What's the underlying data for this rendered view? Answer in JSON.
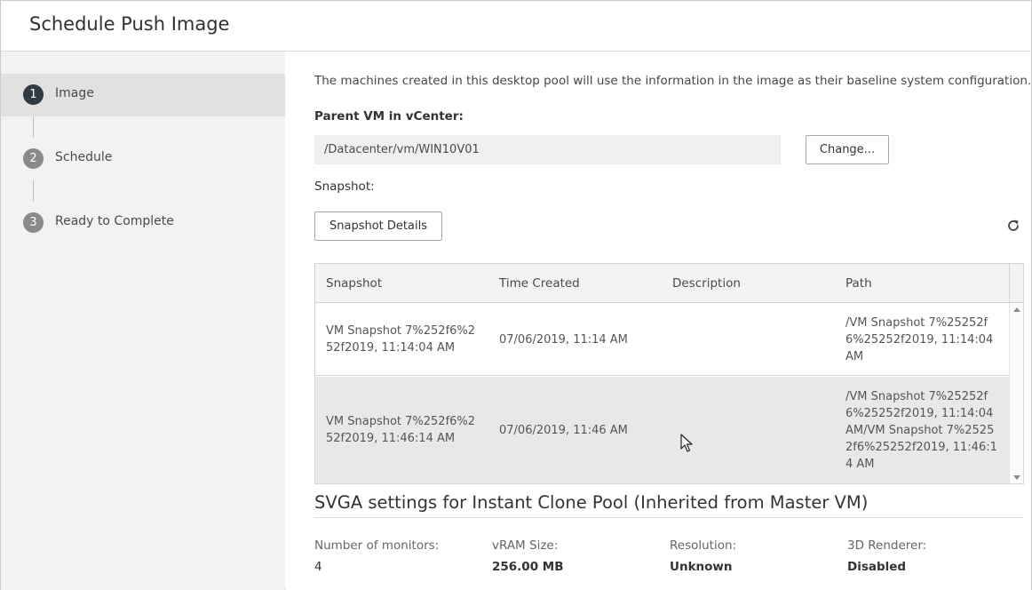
{
  "dialog": {
    "title": "Schedule Push Image"
  },
  "steps": [
    {
      "number": "1",
      "label": "Image",
      "active": true
    },
    {
      "number": "2",
      "label": "Schedule",
      "active": false
    },
    {
      "number": "3",
      "label": "Ready to Complete",
      "active": false
    }
  ],
  "image": {
    "intro_text": "The machines created in this desktop pool will use the information in the image as their baseline system configuration.",
    "parent_vm_label": "Parent VM in vCenter:",
    "parent_vm_value": "/Datacenter/vm/WIN10V01",
    "change_button": "Change...",
    "snapshot_label": "Snapshot:",
    "snapshot_details_button": "Snapshot Details",
    "refresh_icon": "refresh-icon"
  },
  "snapshot_table": {
    "columns": [
      "Snapshot",
      "Time Created",
      "Description",
      "Path"
    ],
    "rows": [
      {
        "snapshot": [
          "VM Snapshot 7%252f6%2",
          "52f2019, 11:14:04 AM"
        ],
        "time_created": "07/06/2019, 11:14 AM",
        "description": "",
        "path": [
          "/VM Snapshot 7%25252f",
          "6%25252f2019, 11:14:04",
          "AM"
        ],
        "selected": false
      },
      {
        "snapshot": [
          "VM Snapshot 7%252f6%2",
          "52f2019, 11:46:14 AM"
        ],
        "time_created": "07/06/2019, 11:46 AM",
        "description": "",
        "path": [
          "/VM Snapshot 7%25252f",
          "6%25252f2019, 11:14:04",
          "AM/VM Snapshot 7%2525",
          "2f6%25252f2019, 11:46:1",
          "4 AM"
        ],
        "selected": true
      }
    ]
  },
  "svga": {
    "title": "SVGA settings for Instant Clone Pool (Inherited from Master VM)",
    "properties": [
      {
        "label": "Number of monitors:",
        "value": "4",
        "bold": false
      },
      {
        "label": "vRAM Size:",
        "value": "256.00 MB",
        "bold": true
      },
      {
        "label": "Resolution:",
        "value": "Unknown",
        "bold": true
      },
      {
        "label": "3D Renderer:",
        "value": "Disabled",
        "bold": true
      }
    ]
  },
  "colors": {
    "active_step_bg": "#e1e1e1",
    "active_step_badge": "#313943",
    "inactive_step_badge": "#8a8a8a",
    "sidebar_bg": "#f2f2f2",
    "selected_row_bg": "#e8e8e8"
  }
}
